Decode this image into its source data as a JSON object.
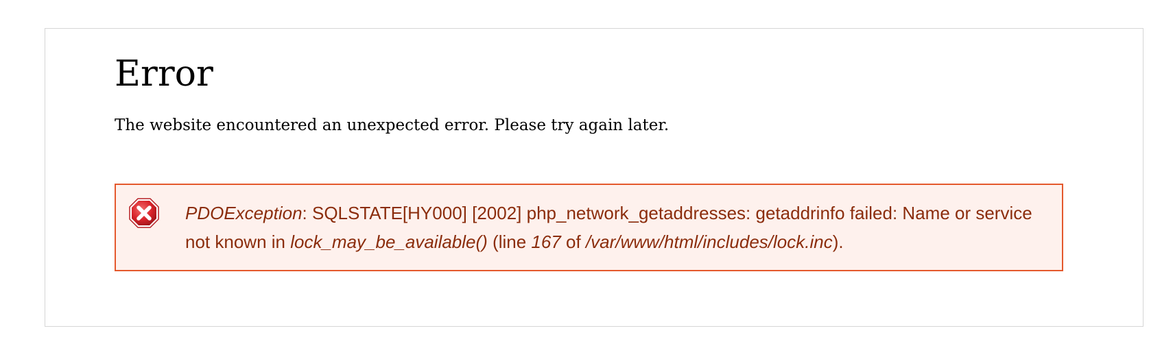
{
  "page": {
    "title": "Error",
    "message": "The website encountered an unexpected error. Please try again later."
  },
  "error": {
    "icon": "error-x-icon",
    "exception_class": "PDOException",
    "message_part1": ": SQLSTATE[HY000] [2002] php_network_getaddresses: getaddrinfo failed: Name or service not known in ",
    "function_name": "lock_may_be_available()",
    "line_prefix": " (line ",
    "line_number": "167",
    "of_text": " of ",
    "file_path": "/var/www/html/includes/lock.inc",
    "suffix": ")."
  },
  "colors": {
    "error_border": "#e4582c",
    "error_background": "#fef1ed",
    "error_text": "#8b2d0d",
    "icon_red": "#d8232a"
  }
}
